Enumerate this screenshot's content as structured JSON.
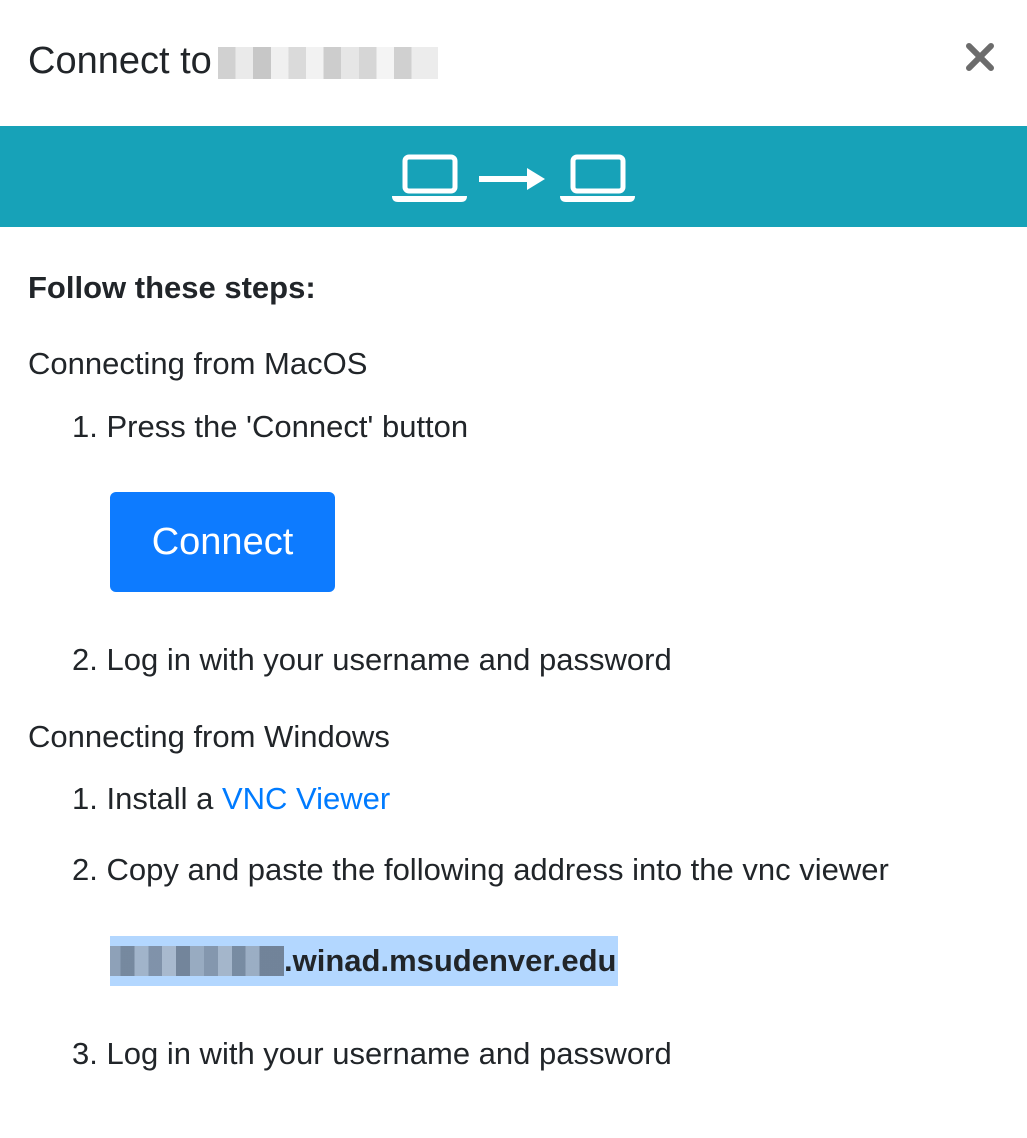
{
  "dialog": {
    "title_prefix": "Connect to",
    "close_glyph": "×",
    "banner_icons": [
      "laptop-icon",
      "arrow-right-icon",
      "laptop-icon"
    ],
    "colors": {
      "banner": "#17a2b8",
      "primary_button": "#0d7bff",
      "link": "#007bff",
      "selection": "#b3d7ff"
    }
  },
  "instructions": {
    "heading": "Follow these steps:",
    "macos": {
      "title": "Connecting from MacOS",
      "step1_num": "1.",
      "step1_text": "Press the 'Connect' button",
      "connect_button": "Connect",
      "step2_num": "2.",
      "step2_text": "Log in with your username and password"
    },
    "windows": {
      "title": "Connecting from Windows",
      "step1_num": "1.",
      "step1_text": "Install a ",
      "step1_link": "VNC Viewer",
      "step2_num": "2.",
      "step2_text": "Copy and paste the following address into the vnc viewer",
      "address_suffix": ".winad.msudenver.edu",
      "step3_num": "3.",
      "step3_text": "Log in with your username and password"
    }
  }
}
